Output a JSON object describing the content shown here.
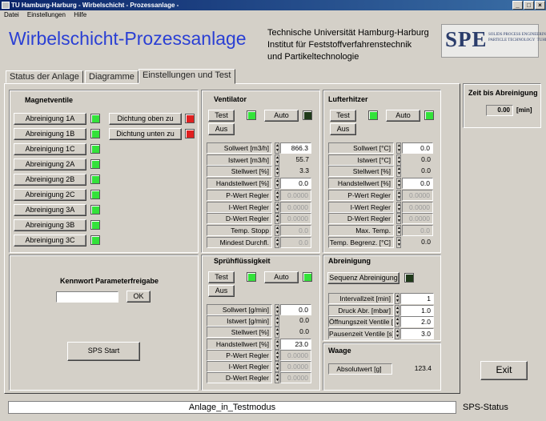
{
  "window": {
    "title": "TU Hamburg-Harburg - Wirbelschicht - Prozessanlage -",
    "min": "_",
    "max": "□",
    "close": "×"
  },
  "menu": [
    "Datei",
    "Einstellungen",
    "Hilfe"
  ],
  "header": {
    "title": "Wirbelschicht-Prozessanlage",
    "inst1": "Technische Universität Hamburg-Harburg",
    "inst2": "Institut für Feststoffverfahrenstechnik",
    "inst3": "und Partikeltechnologie",
    "logo_big": "SPE",
    "logo_small": "SOLIDS PROCESS ENGINEERING &\nPARTICLE TECHNOLOGY  TUHH"
  },
  "tabs": [
    "Status der Anlage",
    "Diagramme",
    "Einstellungen und Test"
  ],
  "magnetventile": {
    "title": "Magnetventile",
    "buttons": [
      "Abreinigung 1A",
      "Abreinigung 1B",
      "Abreinigung 1C",
      "Abreinigung 2A",
      "Abreinigung 2B",
      "Abreinigung 2C",
      "Abreinigung 3A",
      "Abreinigung 3B",
      "Abreinigung 3C"
    ],
    "dichtung": [
      "Dichtung oben zu",
      "Dichtung unten zu"
    ]
  },
  "kennwort": {
    "label": "Kennwort Parameterfreigabe",
    "value": "",
    "ok": "OK",
    "sps_start": "SPS Start"
  },
  "ventilator": {
    "title": "Ventilator",
    "test": "Test",
    "auto": "Auto",
    "aus": "Aus",
    "rows": [
      {
        "label": "Sollwert [m3/h]",
        "value": "866.3",
        "kind": "num"
      },
      {
        "label": "Istwert [m3/h]",
        "value": "55.7",
        "kind": "ro"
      },
      {
        "label": "Stellwert [%]",
        "value": "3.3",
        "kind": "ro"
      },
      {
        "label": "Handstellwert [%]",
        "value": "0.0",
        "kind": "num"
      },
      {
        "label": "P-Wert Regler",
        "value": "0.0000",
        "kind": "dis"
      },
      {
        "label": "I-Wert Regler",
        "value": "0.0000",
        "kind": "dis"
      },
      {
        "label": "D-Wert Regler",
        "value": "0.0000",
        "kind": "dis"
      },
      {
        "label": "Temp. Stopp",
        "value": "0.0",
        "kind": "dis"
      },
      {
        "label": "Mindest Durchfl.",
        "value": "0.0",
        "kind": "dis"
      }
    ]
  },
  "lufterhitzer": {
    "title": "Lufterhitzer",
    "test": "Test",
    "auto": "Auto",
    "aus": "Aus",
    "rows": [
      {
        "label": "Sollwert [°C]",
        "value": "0.0",
        "kind": "num"
      },
      {
        "label": "Istwert [°C]",
        "value": "0.0",
        "kind": "ro"
      },
      {
        "label": "Stellwert [%]",
        "value": "0.0",
        "kind": "ro"
      },
      {
        "label": "Handstellwert [%]",
        "value": "0.0",
        "kind": "num"
      },
      {
        "label": "P-Wert Regler",
        "value": "0.0000",
        "kind": "dis"
      },
      {
        "label": "I-Wert Regler",
        "value": "0.0000",
        "kind": "dis"
      },
      {
        "label": "D-Wert Regler",
        "value": "0.0000",
        "kind": "dis"
      },
      {
        "label": "Max. Temp.",
        "value": "0.0",
        "kind": "dis"
      },
      {
        "label": "Temp. Begrenz. [°C]",
        "value": "0.0",
        "kind": "ro"
      }
    ]
  },
  "spruehfluessigkeit": {
    "title": "Sprühflüssigkeit",
    "test": "Test",
    "auto": "Auto",
    "aus": "Aus",
    "rows": [
      {
        "label": "Sollwert  [g/min]",
        "value": "0.0",
        "kind": "num"
      },
      {
        "label": "Istwert [g/min]",
        "value": "0.0",
        "kind": "ro"
      },
      {
        "label": "Stellwert [%]",
        "value": "0.0",
        "kind": "ro"
      },
      {
        "label": "Handstellwert [%]",
        "value": "23.0",
        "kind": "num"
      },
      {
        "label": "P-Wert Regler",
        "value": "0.0000",
        "kind": "dis"
      },
      {
        "label": "I-Wert Regler",
        "value": "0.0000",
        "kind": "dis"
      },
      {
        "label": "D-Wert Regler",
        "value": "0.0000",
        "kind": "dis"
      }
    ]
  },
  "abreinigung": {
    "title": "Abreinigung",
    "sequenz": "Sequenz Abreinigung",
    "rows": [
      {
        "label": "Intervallzeit [min]",
        "value": "1"
      },
      {
        "label": "Druck Abr. [mbar]",
        "value": "1.0"
      },
      {
        "label": "Öffnungszeit Ventile [s]",
        "value": "2.0"
      },
      {
        "label": "Pausenzeit Ventile [s]",
        "value": "3.0"
      }
    ]
  },
  "waage": {
    "title": "Waage",
    "label": "Absolutwert [g]",
    "value": "123.4"
  },
  "zeit": {
    "title": "Zeit bis Abreinigung",
    "value": "0.00",
    "unit": "[min]"
  },
  "exit": "Exit",
  "status": {
    "value": "Anlage_in_Testmodus",
    "label": "SPS-Status"
  }
}
